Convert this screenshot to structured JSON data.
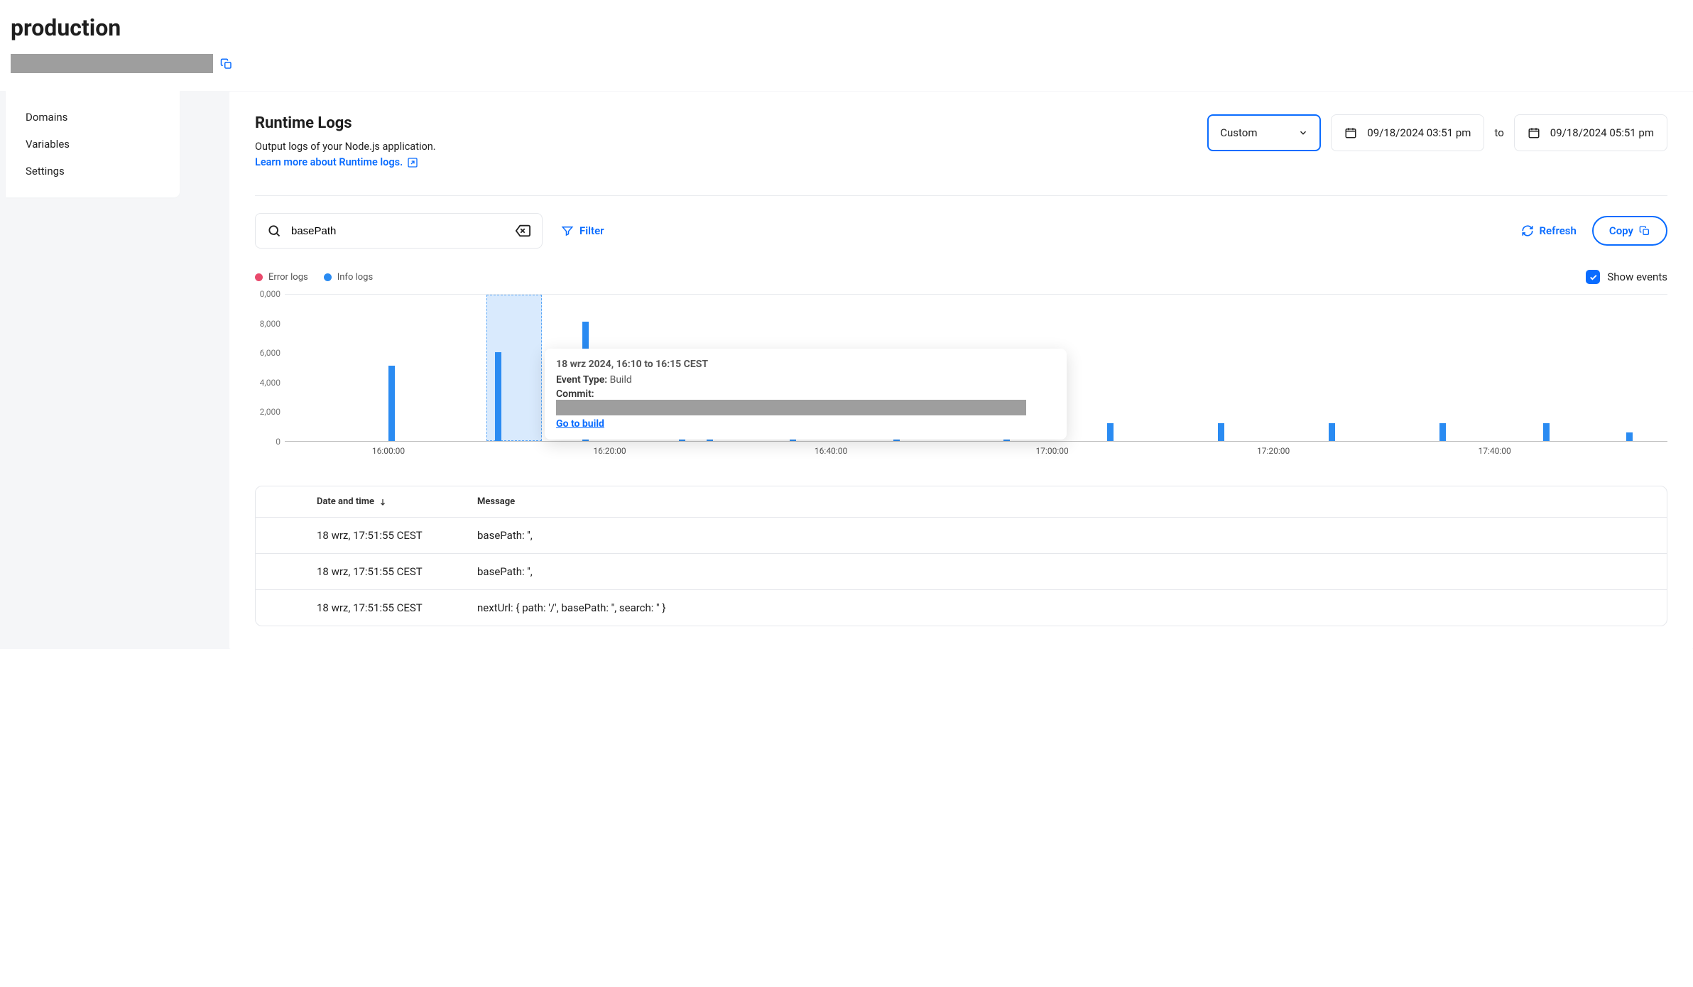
{
  "header": {
    "title": "production"
  },
  "sidebar": {
    "items": [
      {
        "label": "Domains"
      },
      {
        "label": "Variables"
      },
      {
        "label": "Settings"
      }
    ]
  },
  "main": {
    "title": "Runtime Logs",
    "subtext": "Output logs of your Node.js application.",
    "learn_link": "Learn more about Runtime logs."
  },
  "date_controls": {
    "range_mode": "Custom",
    "from": "09/18/2024 03:51 pm",
    "to_label": "to",
    "to": "09/18/2024 05:51 pm"
  },
  "toolbar": {
    "search_value": "basePath",
    "filter_label": "Filter",
    "refresh_label": "Refresh",
    "copy_label": "Copy"
  },
  "legend": {
    "error": "Error logs",
    "info": "Info logs",
    "show_events": "Show events"
  },
  "tooltip": {
    "title": "18 wrz 2024, 16:10 to 16:15 CEST",
    "event_type_label": "Event Type:",
    "event_type_value": "Build",
    "commit_label": "Commit:",
    "go_to_build": "Go to build"
  },
  "table": {
    "columns": {
      "date": "Date and time",
      "message": "Message"
    },
    "rows": [
      {
        "date": "18 wrz, 17:51:55 CEST",
        "message": "basePath: '',"
      },
      {
        "date": "18 wrz, 17:51:55 CEST",
        "message": "basePath: '',"
      },
      {
        "date": "18 wrz, 17:51:55 CEST",
        "message": "nextUrl: { path: '/', basePath: '', search: '' }"
      }
    ]
  },
  "chart_data": {
    "type": "bar",
    "title": "",
    "xlabel": "",
    "ylabel": "",
    "ylim": [
      0,
      10000
    ],
    "y_ticks": [
      0,
      2000,
      4000,
      6000,
      8000
    ],
    "y_tick_labels": [
      "0",
      "2,000",
      "4,000",
      "6,000",
      "8,000",
      "0,000"
    ],
    "x_ticks": [
      "16:00:00",
      "16:20:00",
      "16:40:00",
      "17:00:00",
      "17:20:00",
      "17:40:00"
    ],
    "bars": [
      {
        "x_pct": 7.5,
        "value": 5100
      },
      {
        "x_pct": 15.2,
        "value": 6000
      },
      {
        "x_pct": 21.5,
        "value": 8100
      },
      {
        "x_pct": 28.5,
        "value": 4500
      },
      {
        "x_pct": 30.5,
        "value": 1200
      },
      {
        "x_pct": 36.5,
        "value": 1200
      },
      {
        "x_pct": 44.0,
        "value": 1200
      },
      {
        "x_pct": 52.0,
        "value": 1200
      },
      {
        "x_pct": 59.5,
        "value": 1200
      },
      {
        "x_pct": 67.5,
        "value": 1200
      },
      {
        "x_pct": 75.5,
        "value": 1200
      },
      {
        "x_pct": 83.5,
        "value": 1200
      },
      {
        "x_pct": 91.0,
        "value": 1200
      },
      {
        "x_pct": 97.0,
        "value": 600
      }
    ],
    "selection": {
      "start_pct": 14.6,
      "end_pct": 18.6
    }
  }
}
